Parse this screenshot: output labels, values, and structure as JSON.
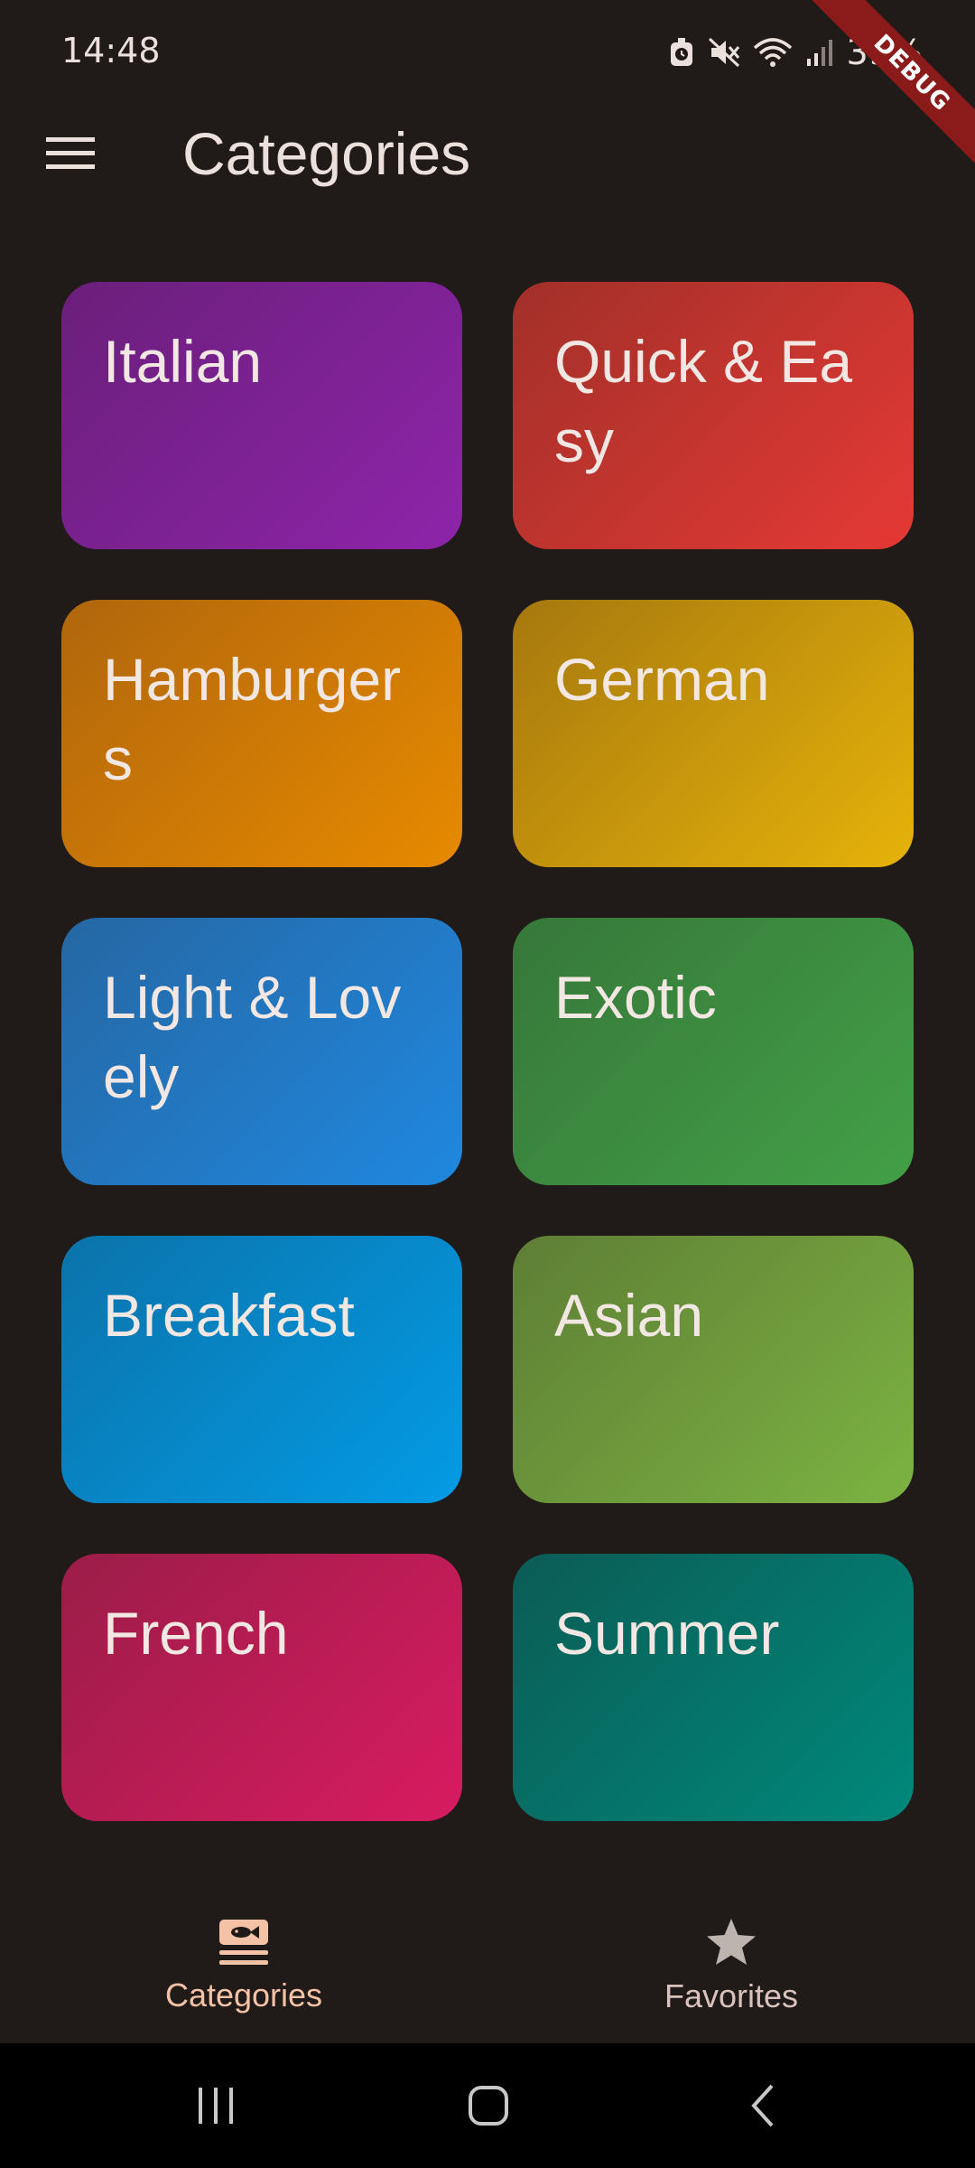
{
  "status_bar": {
    "time": "14:48",
    "battery": "39%",
    "icons": [
      "alarm-icon",
      "mute-icon",
      "wifi-icon",
      "signal-icon"
    ]
  },
  "debug_banner": "DEBUG",
  "app_bar": {
    "title": "Categories",
    "menu_icon": "hamburger-menu-icon"
  },
  "categories": [
    {
      "label": "Italian",
      "color_start": "#6a1f7a",
      "color_end": "#8e24aa"
    },
    {
      "label": "Quick & Easy",
      "color_start": "#a23029",
      "color_end": "#e53935"
    },
    {
      "label": "Hamburgers",
      "color_start": "#b0660c",
      "color_end": "#e78a00"
    },
    {
      "label": "German",
      "color_start": "#a6780e",
      "color_end": "#e6b30a"
    },
    {
      "label": "Light & Lovely",
      "color_start": "#2567a3",
      "color_end": "#2088df"
    },
    {
      "label": "Exotic",
      "color_start": "#36773a",
      "color_end": "#43a047"
    },
    {
      "label": "Breakfast",
      "color_start": "#0b73aa",
      "color_end": "#039be5"
    },
    {
      "label": "Asian",
      "color_start": "#5e7e35",
      "color_end": "#7cb342"
    },
    {
      "label": "French",
      "color_start": "#9b1d48",
      "color_end": "#d81b60"
    },
    {
      "label": "Summer",
      "color_start": "#0b5c55",
      "color_end": "#00897b"
    }
  ],
  "bottom_nav": {
    "items": [
      {
        "label": "Categories",
        "icon": "set-meal-icon",
        "active": true
      },
      {
        "label": "Favorites",
        "icon": "star-icon",
        "active": false
      }
    ]
  },
  "system_nav": {
    "icons": [
      "recents-icon",
      "home-icon",
      "back-icon"
    ]
  },
  "colors": {
    "background": "#201a18",
    "active_nav": "#f4c2a6",
    "text": "#ece0dc"
  }
}
